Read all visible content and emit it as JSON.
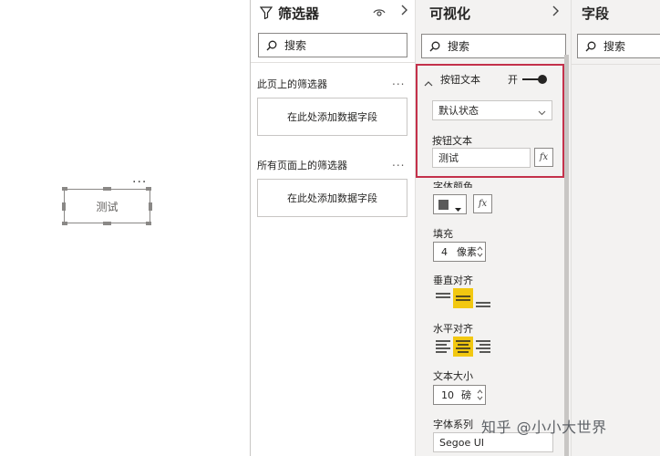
{
  "canvas": {
    "more": "...",
    "button_text": "测试"
  },
  "filters": {
    "title": "筛选器",
    "search_placeholder": "搜索",
    "page_section": "此页上的筛选器",
    "all_pages_section": "所有页面上的筛选器",
    "add_field": "在此处添加数据字段",
    "more": "..."
  },
  "visualize": {
    "title": "可视化",
    "search_placeholder": "搜索",
    "button_text_section": {
      "title": "按钮文本",
      "toggle_label": "开",
      "state_value": "默认状态",
      "text_label": "按钮文本",
      "text_value": "测试"
    },
    "font_color_label": "字体颜色",
    "fx": "fx",
    "fill_label": "填充",
    "fill_value": "4",
    "fill_unit": "像素",
    "vertical_align_label": "垂直对齐",
    "horizontal_align_label": "水平对齐",
    "text_size_label": "文本大小",
    "text_size_value": "10",
    "text_size_unit": "磅",
    "font_family_label": "字体系列",
    "font_family_value": "Segoe UI"
  },
  "fields": {
    "title": "字段",
    "search_placeholder": "搜索"
  },
  "watermark": "知乎 @小小大世界",
  "colors": {
    "highlight": "#c4314b",
    "active": "#f2c811",
    "font_swatch": "#5a5a5a"
  }
}
